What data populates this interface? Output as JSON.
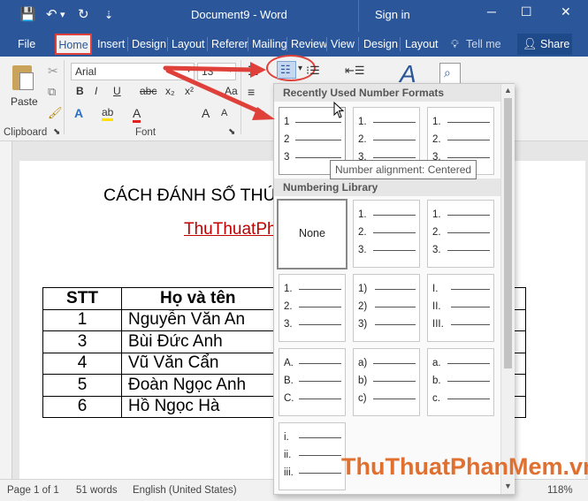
{
  "window": {
    "title": "Document9 - Word",
    "signin": "Sign in",
    "minimize_icon": "─",
    "restore_icon": "☐",
    "close_icon": "✕"
  },
  "qat": {
    "save_icon": "💾",
    "undo_icon": "↶",
    "undo_dropdown": "▾",
    "redo_icon": "↻",
    "customize_icon": "⇣"
  },
  "tabs": [
    "File",
    "Home",
    "Insert",
    "Design",
    "Layout",
    "Referer",
    "Mailing",
    "Review",
    "View",
    "Design",
    "Layout"
  ],
  "tell_me": "Tell me",
  "share": "Share",
  "ribbon": {
    "paste_label": "Paste",
    "clipboard_label": "Clipboard",
    "font_label": "Font",
    "font_name": "Arial",
    "font_size": "13",
    "bold": "B",
    "italic": "I",
    "underline": "U",
    "strike": "abc",
    "subscript": "x₂",
    "superscript": "x²",
    "grow_font": "A",
    "shrink_font": "A",
    "text_effects": "A",
    "highlight": "ab",
    "font_color": "A",
    "change_case": "Aa",
    "clear_format": "A"
  },
  "gallery": {
    "recent_header": "Recently Used Number Formats",
    "library_header": "Numbering Library",
    "none_label": "None",
    "recent": [
      [
        "1",
        "2",
        "3"
      ],
      [
        "1.",
        "2.",
        "3."
      ],
      [
        "1.",
        "2.",
        "3."
      ]
    ],
    "library": [
      [
        [
          "1.",
          "2.",
          "3."
        ],
        [
          "1.",
          "2.",
          "3."
        ]
      ],
      [
        [
          "1.",
          "2.",
          "3."
        ],
        [
          "1)",
          "2)",
          "3)"
        ],
        [
          "I.",
          "II.",
          "III."
        ]
      ],
      [
        [
          "A.",
          "B.",
          "C."
        ],
        [
          "a)",
          "b)",
          "c)"
        ],
        [
          "a.",
          "b.",
          "c."
        ]
      ],
      [
        [
          "i.",
          "ii.",
          "iii."
        ]
      ]
    ]
  },
  "tooltip": "Number alignment: Centered",
  "document": {
    "heading": "CÁCH ĐÁNH SỐ THỨ",
    "subtitle": "ThuThuatPh",
    "table": {
      "headers": [
        "STT",
        "Họ và tên"
      ],
      "rows": [
        [
          "1",
          "Nguyễn Văn An"
        ],
        [
          "3",
          "Bùi Đức Anh"
        ],
        [
          "4",
          "Vũ Văn Cẩn"
        ],
        [
          "5",
          "Đoàn Ngọc Anh"
        ],
        [
          "6",
          "Hồ Ngọc Hà"
        ]
      ]
    }
  },
  "status": {
    "page": "Page 1 of 1",
    "words": "51 words",
    "language": "English (United States)",
    "zoom": "118%"
  },
  "watermark": "ThuThuatPhanMem.vn",
  "colors": {
    "brand": "#2b579a",
    "highlight_box": "#e0403a",
    "subtitle": "#c00000",
    "watermark": "#e07030"
  }
}
